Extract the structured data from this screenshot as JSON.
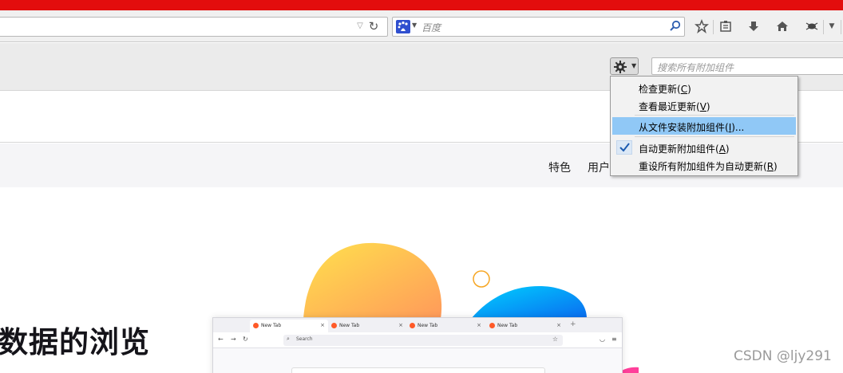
{
  "browser": {
    "search_placeholder": "百度",
    "colors": {
      "titlebar": "#e30d0d",
      "menu_highlight": "#90c8f6"
    },
    "toolbar_icons": [
      "url-dropdown-icon",
      "reload-icon",
      "baidu-icon",
      "search-go-icon",
      "star-icon",
      "reading-list-icon",
      "download-icon",
      "home-icon",
      "addon-icon",
      "menu-chevron-icon"
    ]
  },
  "addons": {
    "search_placeholder": "搜索所有附加组件",
    "gear_icon": "gear-icon",
    "menu": {
      "items": [
        {
          "label": "检查更新(",
          "accel": "C",
          "suffix": ")"
        },
        {
          "label": "查看最近更新(",
          "accel": "V",
          "suffix": ")"
        },
        {
          "label": "从文件安装附加组件(",
          "accel": "I",
          "suffix": ")..."
        },
        {
          "label": "自动更新附加组件(",
          "accel": "A",
          "suffix": ")",
          "checked": true
        },
        {
          "label": "重设所有附加组件为自动更新(",
          "accel": "R",
          "suffix": ")"
        }
      ]
    }
  },
  "page": {
    "nav": {
      "featured": "特色",
      "user": "用户"
    },
    "headline": "数据的浏览",
    "mockup": {
      "tabs": [
        {
          "label": "New Tab",
          "close": "×"
        },
        {
          "label": "New Tab",
          "close": "×"
        },
        {
          "label": "New Tab",
          "close": "×"
        },
        {
          "label": "New Tab",
          "close": "×"
        }
      ],
      "new_tab": "+",
      "search_placeholder": "Search"
    }
  },
  "watermark": "CSDN @ljy291"
}
